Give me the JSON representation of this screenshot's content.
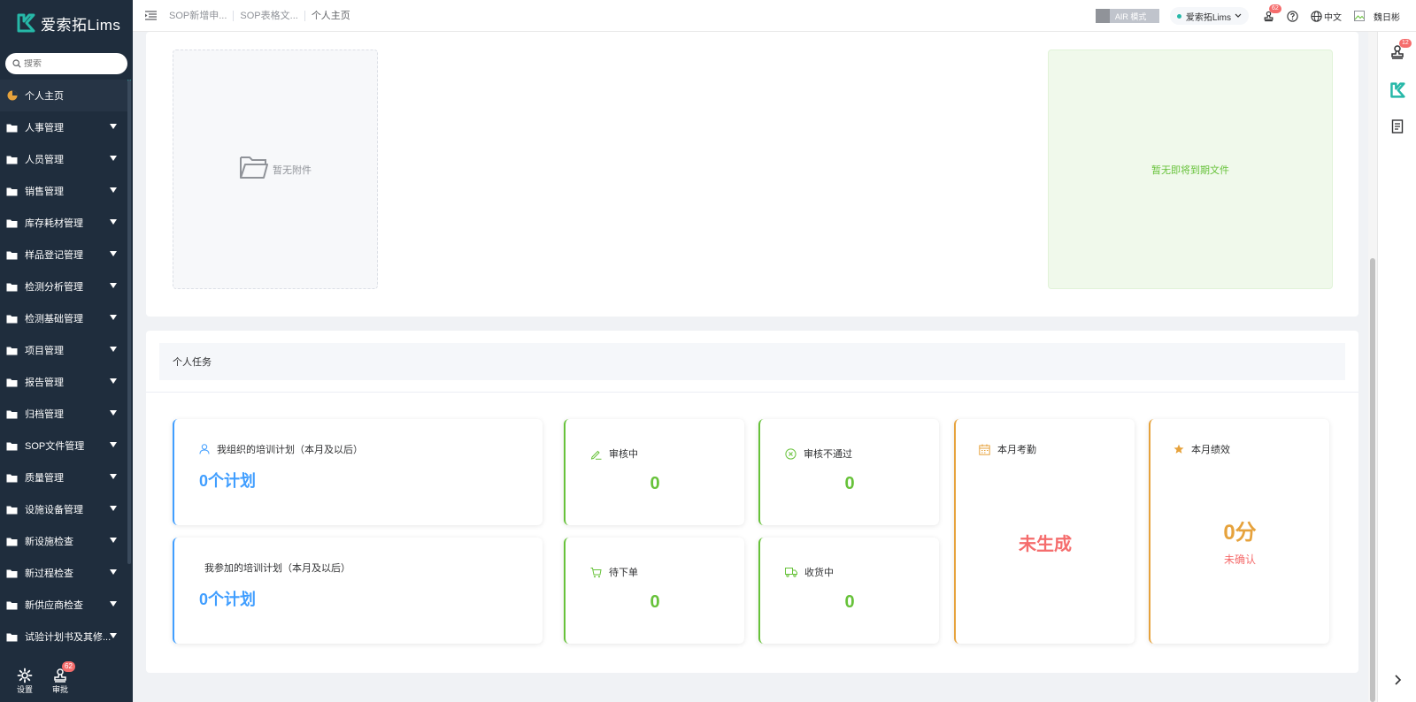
{
  "app": {
    "logo_text": "爱索拓Lims",
    "search_placeholder": "搜索",
    "menu": [
      {
        "label": "个人主页",
        "active": true
      },
      {
        "label": "人事管理"
      },
      {
        "label": "人员管理"
      },
      {
        "label": "销售管理"
      },
      {
        "label": "库存耗材管理"
      },
      {
        "label": "样品登记管理"
      },
      {
        "label": "检测分析管理"
      },
      {
        "label": "检测基础管理"
      },
      {
        "label": "项目管理"
      },
      {
        "label": "报告管理"
      },
      {
        "label": "归档管理"
      },
      {
        "label": "SOP文件管理"
      },
      {
        "label": "质量管理"
      },
      {
        "label": "设施设备管理"
      },
      {
        "label": "新设施检查"
      },
      {
        "label": "新过程检查"
      },
      {
        "label": "新供应商检查"
      },
      {
        "label": "试验计划书及其修..."
      }
    ],
    "bottom": {
      "settings_label": "设置",
      "approve_label": "审批",
      "approve_badge": "62"
    }
  },
  "header": {
    "breadcrumbs": [
      "SOP新增申...",
      "SOP表格文...",
      "个人主页"
    ],
    "air_mode_label": "AIR 模式",
    "org_label": "爱索拓Lims",
    "notify_badge": "62",
    "language_label": "中文",
    "user_name": "魏日彬"
  },
  "rail": {
    "badge": "12"
  },
  "top_section": {
    "no_attachment_text": "暂无附件",
    "no_expire_text": "暂无即将到期文件"
  },
  "tasks": {
    "title": "个人任务",
    "org_training_label": "我组织的培训计划（本月及以后）",
    "org_training_value": "0个计划",
    "join_training_label": "我参加的培训计划（本月及以后）",
    "join_training_value": "0个计划",
    "reviewing_label": "审核中",
    "reviewing_value": "0",
    "rejected_label": "审核不通过",
    "rejected_value": "0",
    "pending_order_label": "待下单",
    "pending_order_value": "0",
    "receiving_label": "收货中",
    "receiving_value": "0",
    "attendance_label": "本月考勤",
    "attendance_value": "未生成",
    "performance_label": "本月绩效",
    "performance_value": "0分",
    "performance_status": "未确认"
  },
  "colors": {
    "sidebar_bg": "#1f2d3d",
    "accent": "#26b8a8",
    "blue": "#409eff",
    "green": "#67c23a",
    "orange": "#e6a23c",
    "red": "#f56c6c"
  }
}
